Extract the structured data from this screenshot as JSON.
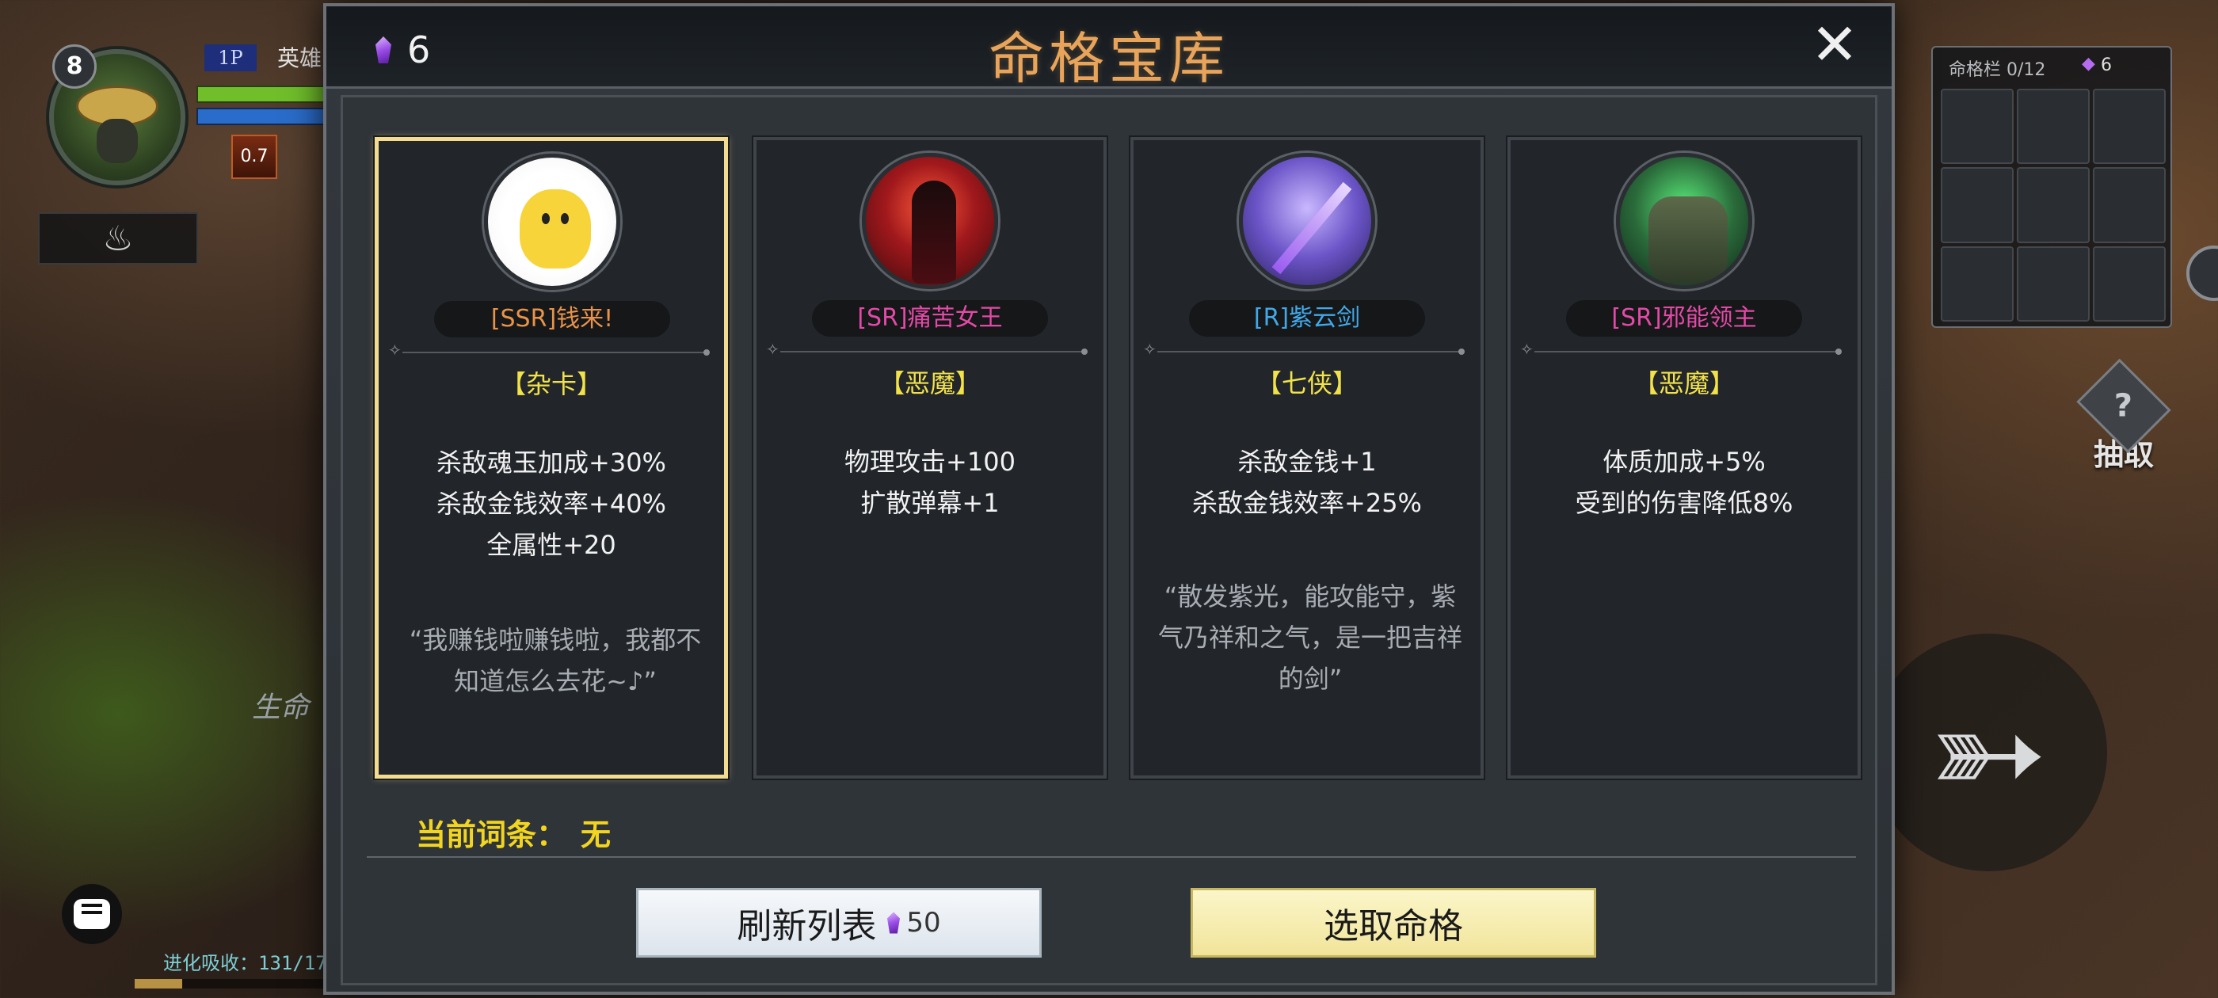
{
  "hud": {
    "level": "8",
    "player_tag": "1P",
    "hero_label": "英雄",
    "buff_value": "0.7",
    "side_text": "生命",
    "evolve_text": "进化吸收：131/17",
    "inventory": {
      "title": "命格栏 0/12",
      "crystal_count": "6",
      "slots": 9
    },
    "draw_label": "抽取"
  },
  "modal": {
    "title": "命格宝库",
    "currency": "6",
    "close_icon": "close-icon",
    "cards": [
      {
        "name": "[SSR]钱来!",
        "rarity": "SSR",
        "faction": "【杂卡】",
        "stats": [
          "杀敌魂玉加成+30%",
          "杀敌金钱效率+40%",
          "全属性+20"
        ],
        "quote": "“我赚钱啦赚钱啦，我都不知道怎么去花~♪”",
        "selected": true
      },
      {
        "name": "[SR]痛苦女王",
        "rarity": "SR",
        "faction": "【恶魔】",
        "stats": [
          "物理攻击+100",
          "扩散弹幕+1"
        ],
        "quote": "",
        "selected": false
      },
      {
        "name": "[R]紫云剑",
        "rarity": "R",
        "faction": "【七侠】",
        "stats": [
          "杀敌金钱+1",
          "杀敌金钱效率+25%"
        ],
        "quote": "“散发紫光，能攻能守，紫气乃祥和之气，是一把吉祥的剑”",
        "selected": false
      },
      {
        "name": "[SR]邪能领主",
        "rarity": "SR",
        "faction": "【恶魔】",
        "stats": [
          "体质加成+5%",
          "受到的伤害降低8%"
        ],
        "quote": "",
        "selected": false
      }
    ],
    "current_entry_label": "当前词条：",
    "current_entry_value": "无",
    "refresh_label": "刷新列表",
    "refresh_cost": "50",
    "select_label": "选取命格"
  },
  "colors": {
    "title": "#e8a45a",
    "ssr": "#e8934a",
    "sr": "#e24aa6",
    "r": "#42a8e8",
    "faction": "#f2e24a",
    "selected_border": "#f3dc8f"
  }
}
